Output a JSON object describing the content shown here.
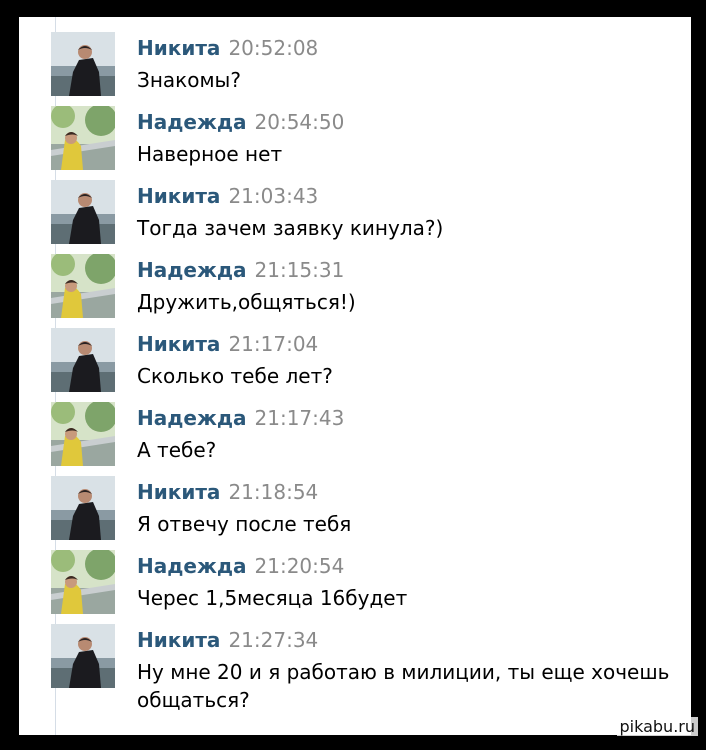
{
  "colors": {
    "background": "#000000",
    "panel": "#ffffff",
    "author": "#2b587a",
    "timestamp": "#8a8a8a",
    "message": "#000000"
  },
  "messages": [
    {
      "author": "Никита",
      "avatar": "nikita-avatar",
      "time": "20:52:08",
      "text": "Знакомы?"
    },
    {
      "author": "Надежда",
      "avatar": "nadezhda-avatar",
      "time": "20:54:50",
      "text": "Наверное нет"
    },
    {
      "author": "Никита",
      "avatar": "nikita-avatar",
      "time": "21:03:43",
      "text": "Тогда зачем заявку кинула?)"
    },
    {
      "author": "Надежда",
      "avatar": "nadezhda-avatar",
      "time": "21:15:31",
      "text": "Дружить,общяться!)"
    },
    {
      "author": "Никита",
      "avatar": "nikita-avatar",
      "time": "21:17:04",
      "text": "Сколько тебе лет?"
    },
    {
      "author": "Надежда",
      "avatar": "nadezhda-avatar",
      "time": "21:17:43",
      "text": "А тебе?"
    },
    {
      "author": "Никита",
      "avatar": "nikita-avatar",
      "time": "21:18:54",
      "text": "Я отвечу после тебя"
    },
    {
      "author": "Надежда",
      "avatar": "nadezhda-avatar",
      "time": "21:20:54",
      "text": "Черес 1,5месяца 16будет"
    },
    {
      "author": "Никита",
      "avatar": "nikita-avatar",
      "time": "21:27:34",
      "text": "Ну мне 20 и я работаю в милиции, ты еще хочешь общаться?"
    }
  ],
  "watermark": "pikabu.ru"
}
